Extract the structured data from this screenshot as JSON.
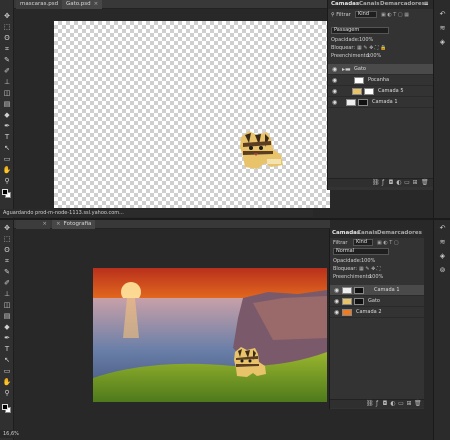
{
  "window_top": {
    "tabs": [
      {
        "label": "mascaras.psd",
        "close": "×"
      },
      {
        "label": "Gato.psd",
        "close": "×"
      }
    ],
    "status": "Aguardando prod-m-node-1113.ssl.yahoo.com...",
    "panel": {
      "tabs": [
        "Camadas",
        "Canais",
        "Demarcadores"
      ],
      "filter_label": "Filtrar",
      "filter_kind": "Kind",
      "blend_mode": "Passagem",
      "opacity_label": "Opacidade:",
      "opacity_value": "100%",
      "lock_label": "Bloquear:",
      "fill_label": "Preenchimento:",
      "fill_value": "100%",
      "layers": [
        {
          "name": "Gato",
          "type": "group"
        },
        {
          "name": "Pocanha",
          "type": "layer"
        },
        {
          "name": "Camada 5",
          "type": "masked"
        },
        {
          "name": "Camada 1",
          "type": "masked"
        }
      ]
    }
  },
  "window_bottom": {
    "tabs": [
      {
        "label": "",
        "close": "×"
      },
      {
        "label": "Fotografia",
        "close": "×"
      }
    ],
    "status": "16,6%",
    "panel": {
      "tabs": [
        "Camadas",
        "Canais",
        "Demarcadores"
      ],
      "filter_label": "Filtrar",
      "filter_kind": "Kind",
      "blend_mode": "Normal",
      "opacity_label": "Opacidade:",
      "opacity_value": "100%",
      "lock_label": "Bloquear:",
      "fill_label": "Preenchimento:",
      "fill_value": "100%",
      "layers": [
        {
          "name": "Camada 1",
          "type": "masked"
        },
        {
          "name": "Gato",
          "type": "masked"
        },
        {
          "name": "Camada 2",
          "type": "image"
        }
      ]
    }
  },
  "colors": {
    "app_bg": "#282828",
    "panel_bg": "#333333",
    "sky_orange": "#f07a1f",
    "cat_yellow": "#e8c36a"
  }
}
